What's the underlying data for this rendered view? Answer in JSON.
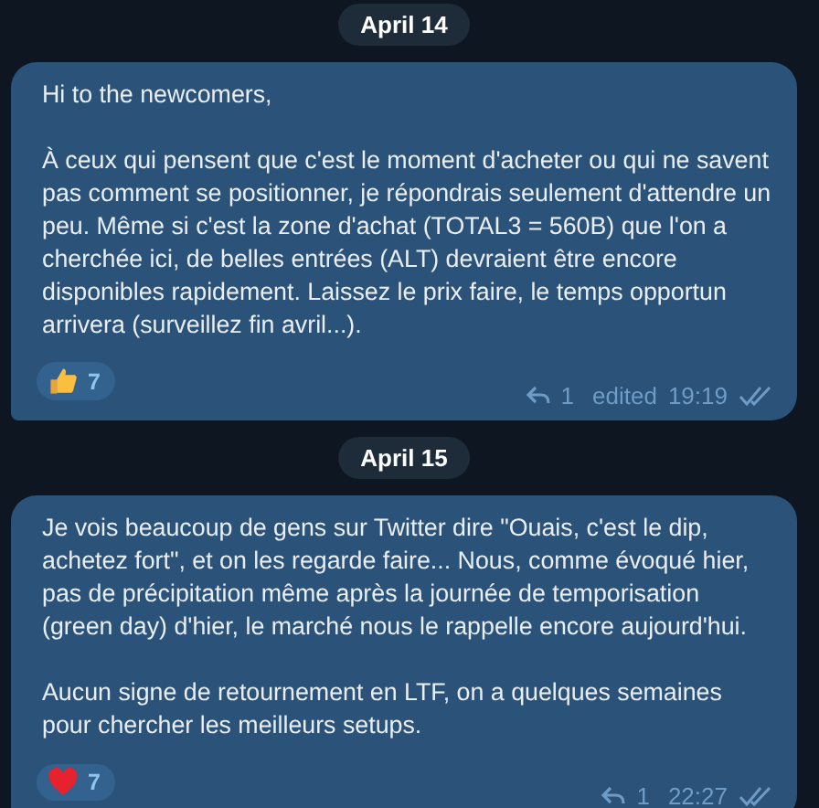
{
  "messages": [
    {
      "date": "April 14",
      "paragraphs": [
        "Hi to the newcomers,",
        "À ceux qui pensent que c'est le moment d'acheter ou qui ne savent pas comment se positionner, je répondrais seulement d'attendre un peu. Même si c'est la zone d'achat (TOTAL3 = 560B) que l'on a cherchée ici, de belles entrées (ALT) devraient être encore disponibles rapidement. Laissez le prix faire, le temps opportun arrivera (surveillez fin avril...)."
      ],
      "reaction": {
        "kind": "thumbs",
        "count": "7"
      },
      "replies": "1",
      "edited": "edited",
      "time": "19:19",
      "read": true
    },
    {
      "date": "April 15",
      "paragraphs": [
        "Je vois beaucoup de gens sur Twitter dire \"Ouais, c'est le dip, achetez fort\", et on les regarde faire... Nous, comme évoqué hier, pas de précipitation même après la journée de temporisation (green day) d'hier, le marché nous le rappelle encore aujourd'hui.",
        "Aucun signe de retournement en LTF, on a quelques semaines pour chercher les meilleurs setups."
      ],
      "reaction": {
        "kind": "heart",
        "count": "7"
      },
      "replies": "1",
      "time": "22:27",
      "read": true
    }
  ]
}
